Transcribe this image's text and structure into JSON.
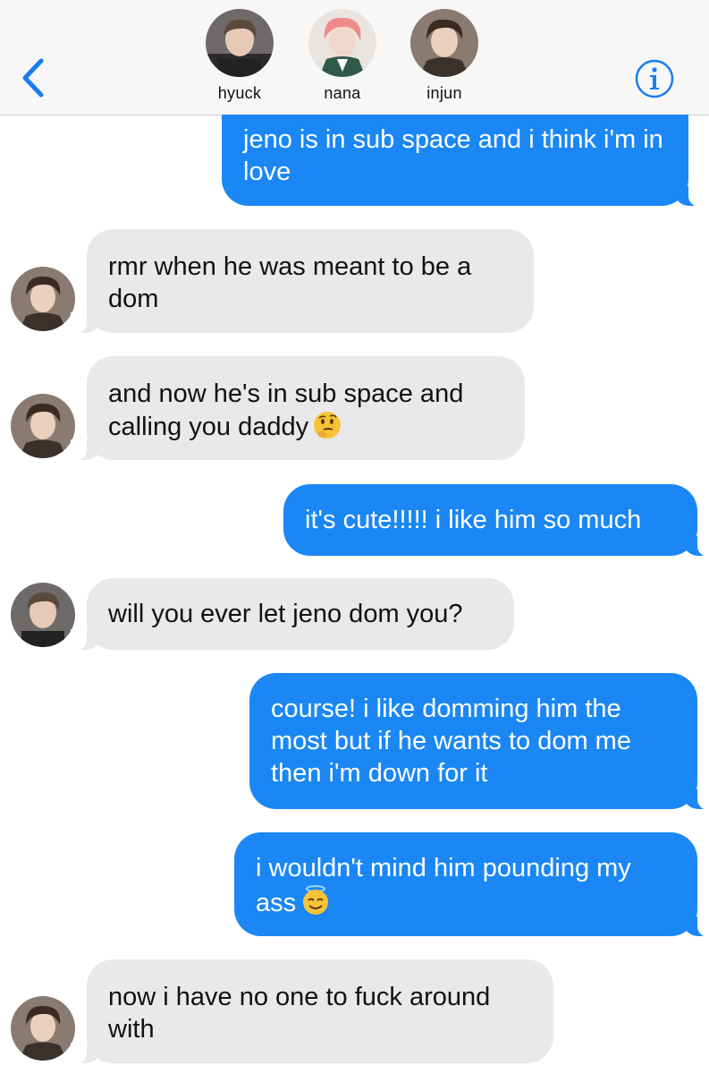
{
  "header": {
    "back_icon": "chevron-left-icon",
    "info_icon": "info-icon",
    "participants": [
      {
        "name": "hyuck"
      },
      {
        "name": "nana"
      },
      {
        "name": "injun"
      }
    ]
  },
  "colors": {
    "accent": "#1a87f5",
    "sent_bubble": "#1a87f5",
    "received_bubble": "#e9e9eb",
    "header_bg": "#f7f7f7"
  },
  "messages": [
    {
      "direction": "sent",
      "text": "jeno is in sub space and i think i'm in love"
    },
    {
      "direction": "received",
      "sender": "injun",
      "text": "rmr when he was meant to be a dom"
    },
    {
      "direction": "received",
      "sender": "injun",
      "text": "and now he's in sub space and calling you daddy",
      "emoji": "thinking-face-emoji"
    },
    {
      "direction": "sent",
      "text": "it's cute!!!!! i like him so much"
    },
    {
      "direction": "received",
      "sender": "hyuck",
      "text": "will you ever let jeno dom you?"
    },
    {
      "direction": "sent",
      "text": "course! i like domming him the most but if he wants to dom me then i'm down for it"
    },
    {
      "direction": "sent",
      "text": "i wouldn't mind him pounding my ass",
      "emoji": "smiling-face-with-halo-emoji"
    },
    {
      "direction": "received",
      "sender": "injun",
      "text": "now i have no one to fuck around with"
    }
  ]
}
